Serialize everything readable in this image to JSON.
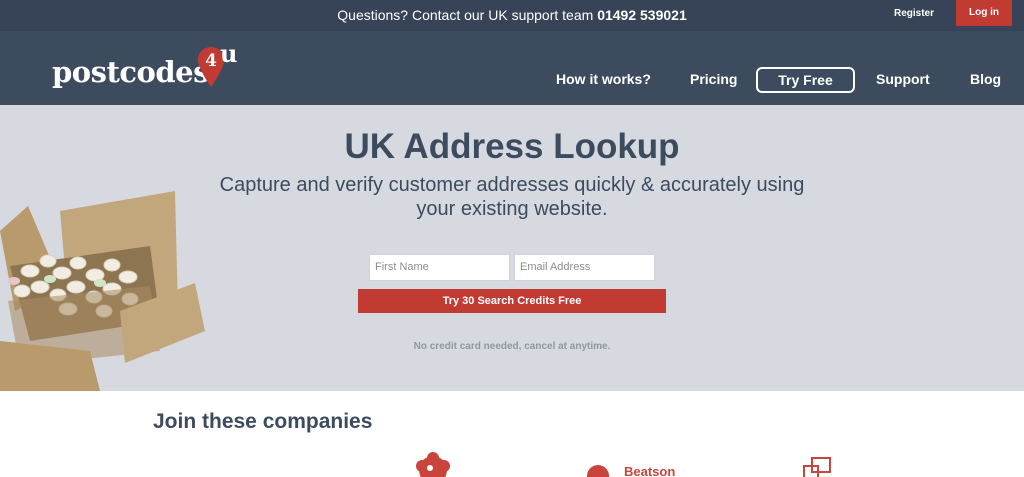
{
  "topbar": {
    "support_text": "Questions? Contact our UK support team",
    "phone": "01492 539021",
    "register": "Register",
    "login": "Log in"
  },
  "logo": {
    "word": "postcodes",
    "pin_text": "4",
    "suffix": "u"
  },
  "nav": {
    "how_it_works": "How it works?",
    "pricing": "Pricing",
    "try_free": "Try Free",
    "support": "Support",
    "blog": "Blog"
  },
  "hero": {
    "title": "UK Address Lookup",
    "subtitle": "Capture and verify customer addresses quickly & accurately using your existing website.",
    "first_name_placeholder": "First Name",
    "email_placeholder": "Email Address",
    "cta": "Try 30 Search Credits Free",
    "note": "No credit card needed, cancel at anytime."
  },
  "companies": {
    "heading": "Join these companies",
    "logo_b_text": "Beatson"
  },
  "colors": {
    "topbar": "#374457",
    "header": "#3d4b5f",
    "hero_bg": "#d6d9e0",
    "accent_red": "#c23b33"
  }
}
